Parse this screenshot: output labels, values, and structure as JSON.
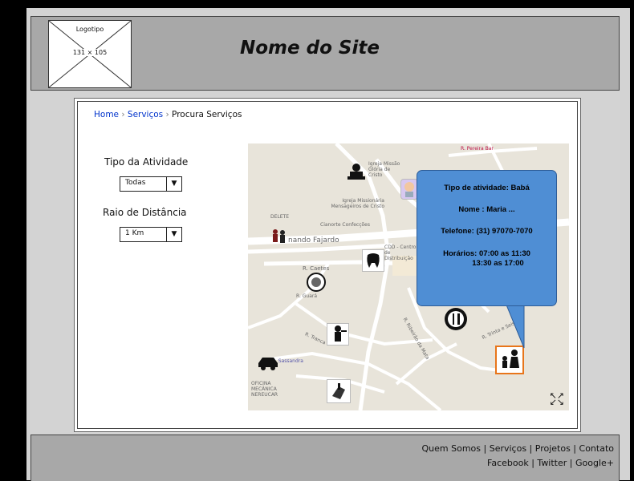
{
  "header": {
    "logo_label": "Logotipo",
    "logo_size": "131 × 105",
    "site_title": "Nome do Site"
  },
  "breadcrumb": {
    "home": "Home",
    "servicos": "Serviços",
    "current": "Procura Serviços",
    "separator": "›"
  },
  "filters": {
    "activity_label": "Tipo da Atividade",
    "activity_value": "Todas",
    "radius_label": "Raio de Distância",
    "radius_value": "1 Km"
  },
  "map": {
    "street_labels": [
      "R. Pereira Bar",
      "Igreja Missão Glória de Cristo",
      "Igreja Missionária Mensageiros de Cristo",
      "DELETE",
      "Cianorte Confecções",
      "nando Fajardo",
      "CDD - Centro de Distribuição",
      "R. Caetes",
      "R. Guará",
      "R. Sassandra",
      "R. Tranca",
      "OFICINA MECÂNICA NEREUCAR",
      "R. Ribeirão da Mata",
      "R. Trinta e Seis"
    ],
    "icons": [
      "dj-icon",
      "baby-icon",
      "elderly-care-icon",
      "dentist-icon",
      "beauty-mask-icon",
      "restaurant-icon",
      "waiter-icon",
      "babysitter-icon",
      "car-mechanic-icon",
      "manicure-icon",
      "expand-icon"
    ],
    "popup": {
      "tipo": "Tipo de atividade: Babá",
      "nome": "Nome : Maria ...",
      "telefone": "Telefone: (31) 97070-7070",
      "horarios_1": "Horários: 07:00 as 11:30",
      "horarios_2": "13:30 as  17:00"
    },
    "popup_color": "#4f8ed4",
    "selected_border_color": "#e8751a"
  },
  "footer": {
    "line1": "Quem Somos | Serviços | Projetos | Contato",
    "line2": "Facebook | Twitter | Google+"
  }
}
